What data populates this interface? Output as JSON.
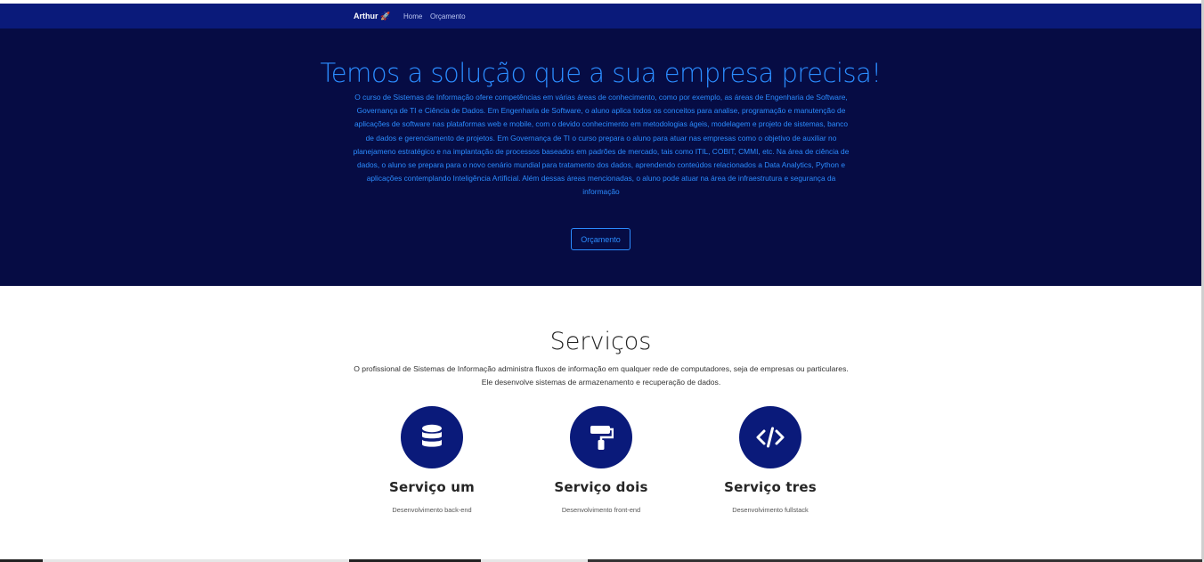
{
  "navbar": {
    "brand": "Arthur 🚀",
    "links": [
      "Home",
      "Orçamento"
    ]
  },
  "hero": {
    "title": "Temos a solução que a sua empresa precisa!",
    "text": "O curso de Sistemas de Informação ofere competências em várias áreas de conhecimento, como por exemplo, as áreas de Engenharia de Software, Governança de TI e Ciência de Dados. Em Engenharia de Software, o aluno aplica todos os conceitos para analise, programação e manutenção de aplicações de software nas plataformas web e mobile, com o devido conhecimento em metodologias ágeis, modelagem e projeto de sistemas, banco de dados e gerenciamento de projetos. Em Governança de TI o curso prepara o aluno para atuar nas empresas como o objetivo de auxiliar no planejameno estratégico e na implantação de processos baseados em padrões de mercado, tais como ITIL, COBIT, CMMI, etc. Na área de ciência de dados, o aluno se prepara para o novo cenário mundial para tratamento dos dados, aprendendo conteúdos relacionados a Data Analytics, Python e aplicações contemplando Inteligência Artificial. Além dessas áreas mencionadas, o aluno pode atuar na área de infraestrutura e segurança da informação",
    "button": "Orçamento"
  },
  "services": {
    "title": "Serviços",
    "text": "O profissional de Sistemas de Informação administra fluxos de informação em qualquer rede de computadores, seja de empresas ou particulares. Ele desenvolve sistemas de armazenamento e recuperação de dados.",
    "items": [
      {
        "name": "Serviço um",
        "desc": "Desenvolvimento back-end",
        "icon": "database-icon"
      },
      {
        "name": "Serviço dois",
        "desc": "Desenvolvimento front-end",
        "icon": "paint-roller-icon"
      },
      {
        "name": "Serviço tres",
        "desc": "Desenvolvimento fullstack",
        "icon": "code-icon"
      }
    ]
  },
  "colors": {
    "navbar": "#0a1a7a",
    "hero_bg": "#060c44",
    "accent": "#2b8cff",
    "icon_circle": "#0a1a7a"
  }
}
